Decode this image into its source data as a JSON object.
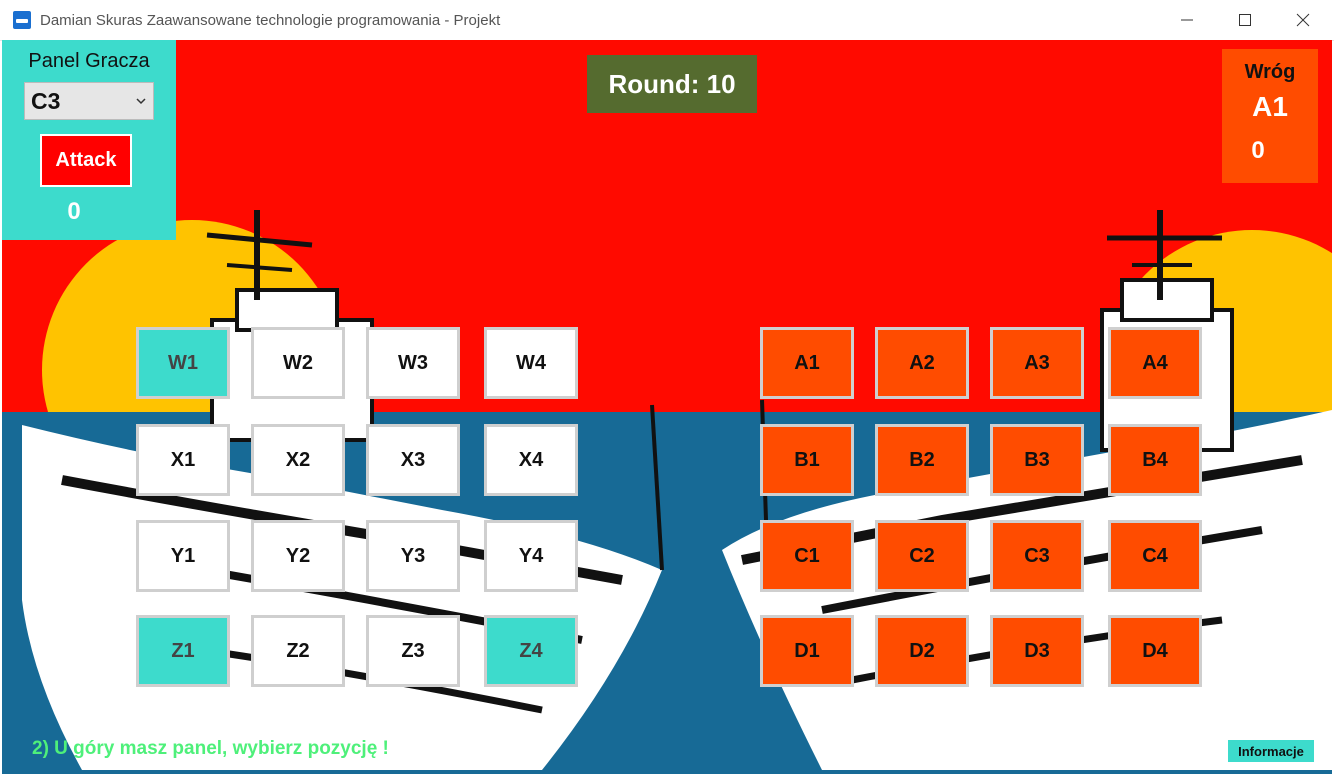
{
  "window": {
    "title": "Damian Skuras Zaawansowane technologie programowania - Projekt"
  },
  "player_panel": {
    "title": "Panel Gracza",
    "selected_position": "C3",
    "attack_label": "Attack",
    "score": "0"
  },
  "round_label": "Round: 10",
  "enemy_panel": {
    "title": "Wróg",
    "target": "A1",
    "score": "0"
  },
  "player_grid": {
    "cells": [
      {
        "label": "W1",
        "state": "teal"
      },
      {
        "label": "W2",
        "state": "white"
      },
      {
        "label": "W3",
        "state": "white"
      },
      {
        "label": "W4",
        "state": "white"
      },
      {
        "label": "X1",
        "state": "white"
      },
      {
        "label": "X2",
        "state": "white"
      },
      {
        "label": "X3",
        "state": "white"
      },
      {
        "label": "X4",
        "state": "white"
      },
      {
        "label": "Y1",
        "state": "white"
      },
      {
        "label": "Y2",
        "state": "white"
      },
      {
        "label": "Y3",
        "state": "white"
      },
      {
        "label": "Y4",
        "state": "white"
      },
      {
        "label": "Z1",
        "state": "teal"
      },
      {
        "label": "Z2",
        "state": "white"
      },
      {
        "label": "Z3",
        "state": "white"
      },
      {
        "label": "Z4",
        "state": "teal"
      }
    ]
  },
  "enemy_grid": {
    "cells": [
      {
        "label": "A1",
        "state": "orange"
      },
      {
        "label": "A2",
        "state": "orange"
      },
      {
        "label": "A3",
        "state": "orange"
      },
      {
        "label": "A4",
        "state": "orange"
      },
      {
        "label": "B1",
        "state": "orange"
      },
      {
        "label": "B2",
        "state": "orange"
      },
      {
        "label": "B3",
        "state": "orange"
      },
      {
        "label": "B4",
        "state": "orange"
      },
      {
        "label": "C1",
        "state": "orange"
      },
      {
        "label": "C2",
        "state": "orange"
      },
      {
        "label": "C3",
        "state": "orange"
      },
      {
        "label": "C4",
        "state": "orange"
      },
      {
        "label": "D1",
        "state": "orange"
      },
      {
        "label": "D2",
        "state": "orange"
      },
      {
        "label": "D3",
        "state": "orange"
      },
      {
        "label": "D4",
        "state": "orange"
      }
    ]
  },
  "hint": "2) U góry masz panel, wybierz pozycję !",
  "info_label": "Informacje",
  "colors": {
    "sky": "#ff0a00",
    "sea": "#176a96",
    "sun": "#ffc300",
    "player_panel": "#3ddbcc",
    "enemy": "#ff4c00",
    "round_box": "#556b2f",
    "hint_text": "#4ef07a"
  },
  "icons": {
    "app": "battleship-app-icon",
    "minimize": "minimize-icon",
    "maximize": "maximize-icon",
    "close": "close-icon",
    "dropdown": "chevron-down-icon"
  }
}
